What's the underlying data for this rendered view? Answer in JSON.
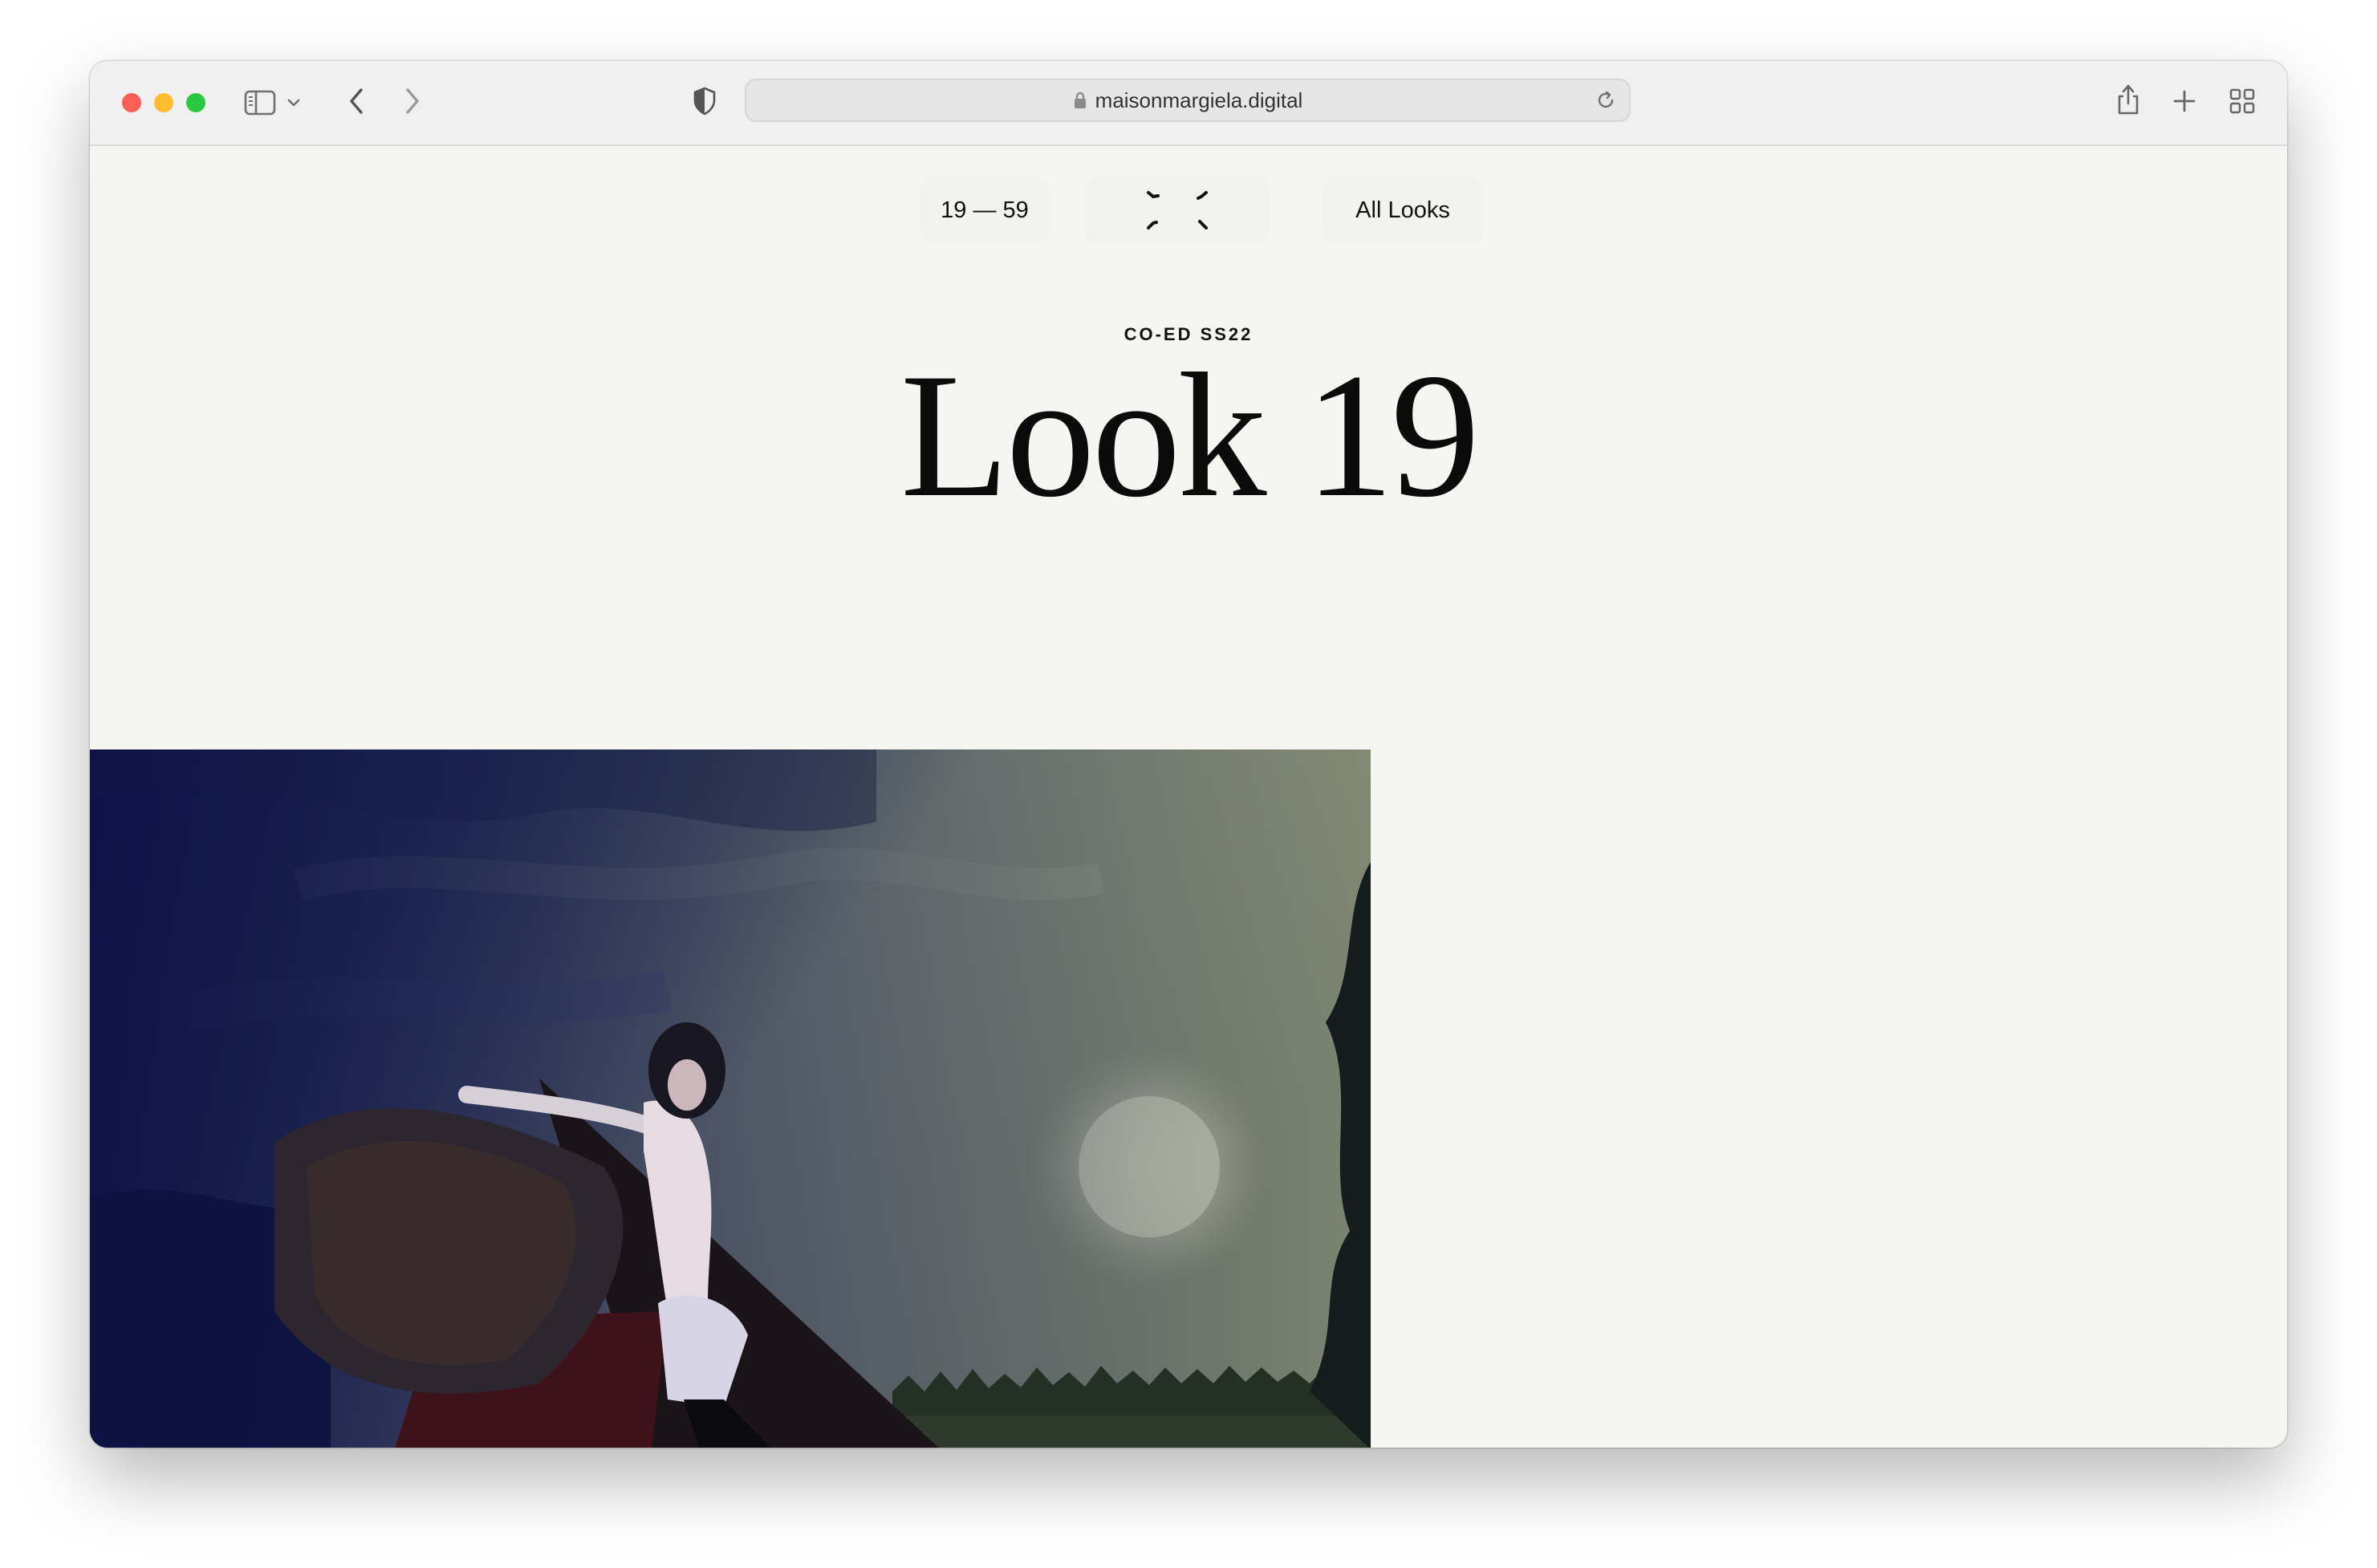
{
  "browser": {
    "url": "maisonmargiela.digital",
    "icons": {
      "sidebar": "sidebar-icon",
      "chevron": "chevron-down-icon",
      "back": "back-arrow-icon",
      "forward": "forward-arrow-icon",
      "shield": "shield-icon",
      "lock": "lock-icon",
      "reload": "reload-icon",
      "share": "share-icon",
      "new_tab": "plus-icon",
      "tabs": "tab-overview-icon"
    }
  },
  "nav": {
    "range": "19 — 59",
    "all_looks": "All Looks",
    "center_icon": "loading-spinner-icon"
  },
  "look": {
    "collection": "CO-ED SS22",
    "title": "Look 19"
  },
  "hero": {
    "image": "hooded-figure-under-moonlit-sky-photo"
  },
  "colors": {
    "page_bg": "#f5f5f1",
    "text": "#0b0b0b"
  }
}
